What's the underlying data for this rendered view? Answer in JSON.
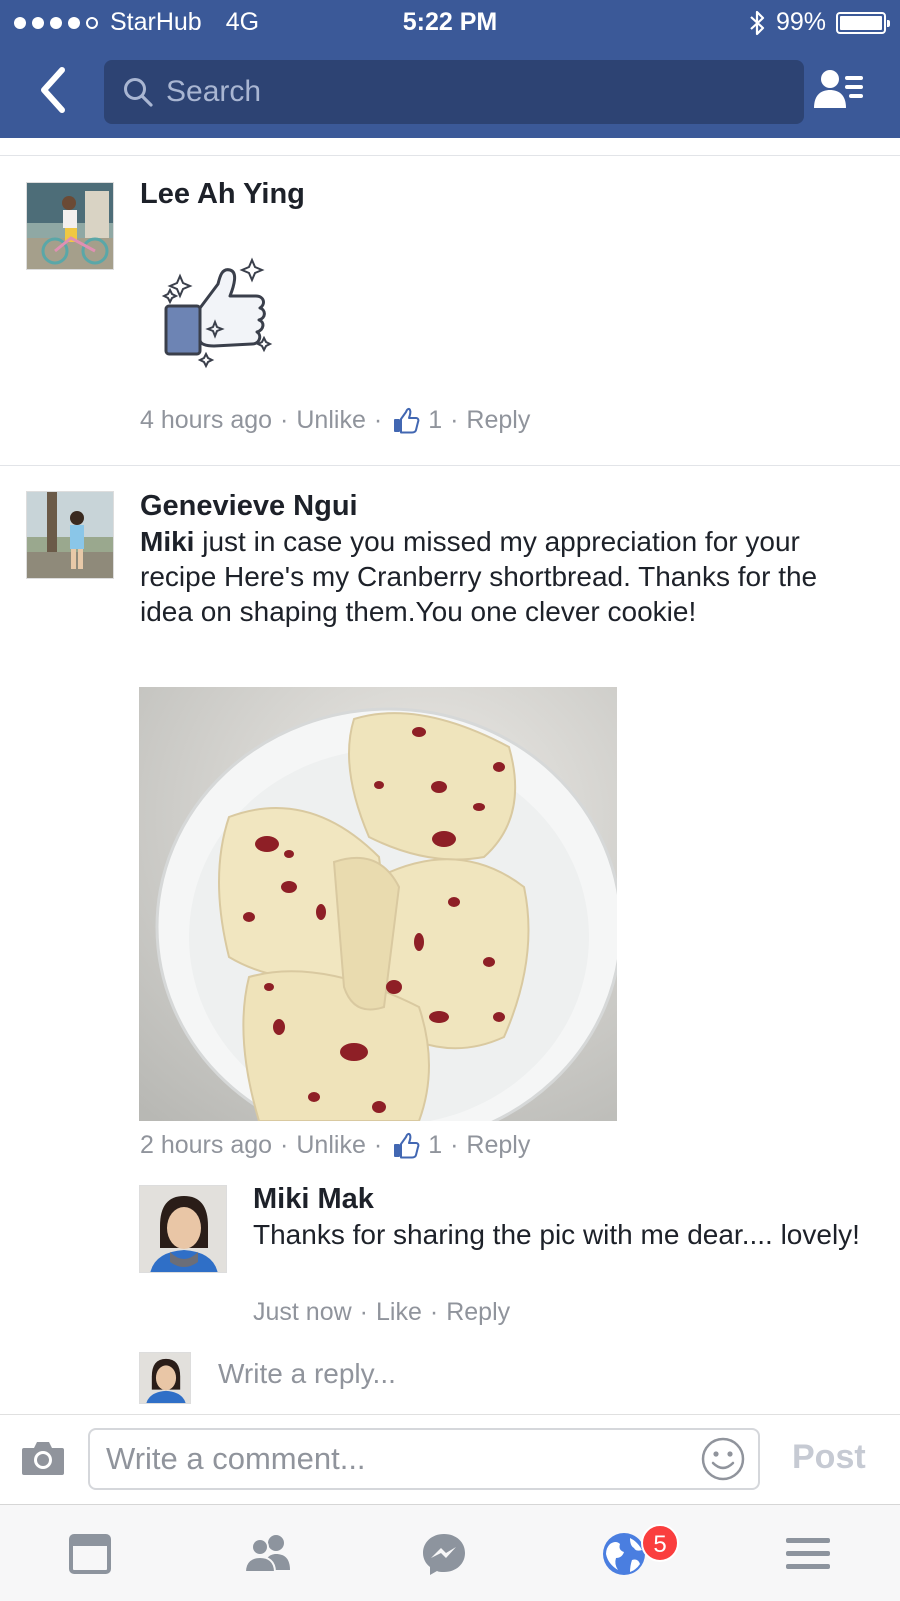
{
  "status_bar": {
    "carrier": "StarHub",
    "network": "4G",
    "time": "5:22 PM",
    "battery": "99%",
    "signal_bars": 4
  },
  "header": {
    "search_placeholder": "Search",
    "back_icon": "chevron-left-icon",
    "friends_icon": "friend-list-icon"
  },
  "comments": [
    {
      "author": "Lee Ah Ying",
      "sticker": "thumbs-up-sticker",
      "time": "4 hours ago",
      "like_action": "Unlike",
      "like_count": "1",
      "reply_action": "Reply"
    },
    {
      "author": "Genevieve Ngui",
      "mention": "Miki",
      "text": " just in case you missed my appreciation for your recipe Here's my Cranberry shortbread. Thanks for the idea on shaping them.You one clever cookie!",
      "photo": "cranberry-shortbread-photo",
      "time": "2 hours ago",
      "like_action": "Unlike",
      "like_count": "1",
      "reply_action": "Reply",
      "replies": [
        {
          "author": "Miki Mak",
          "text": "Thanks for sharing the pic with me dear.... lovely!",
          "time": "Just now",
          "like_action": "Like",
          "reply_action": "Reply"
        }
      ],
      "reply_placeholder": "Write a reply..."
    }
  ],
  "composer": {
    "placeholder": "Write a comment...",
    "post_label": "Post"
  },
  "tabbar": {
    "items": [
      "news-feed-icon",
      "friends-icon",
      "messenger-icon",
      "notifications-globe-icon",
      "menu-icon"
    ],
    "notification_count": "5"
  },
  "colors": {
    "brand": "#3b5998",
    "link": "#4267b2",
    "meta": "#90949c",
    "badge": "#fa3e3e"
  }
}
